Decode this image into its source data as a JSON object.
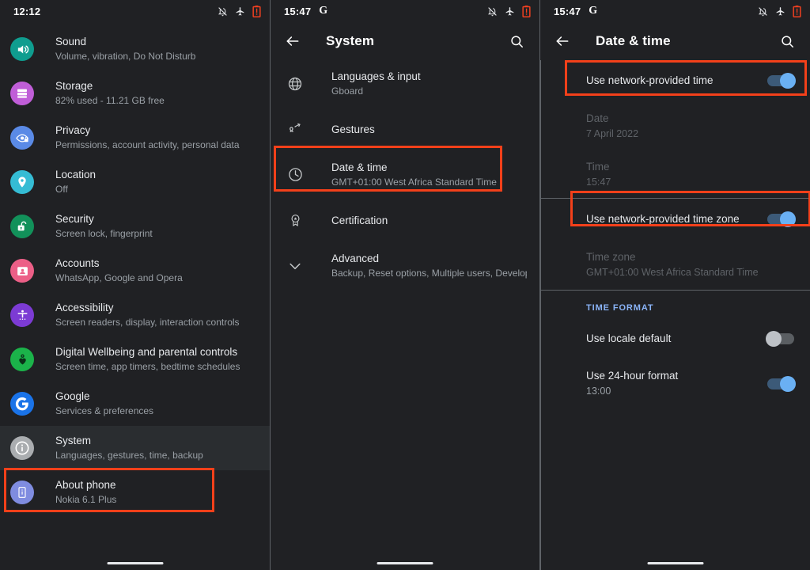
{
  "panels": {
    "settings": {
      "status": {
        "clock": "12:12",
        "glogo": "",
        "icons": [
          "notifications-off-icon",
          "airplane-mode-icon",
          "battery-alert-icon"
        ]
      },
      "items": [
        {
          "title": "Sound",
          "subtitle": "Volume, vibration, Do Not Disturb",
          "icon": "volume-icon",
          "color": "#0f9d8f",
          "selected": false
        },
        {
          "title": "Storage",
          "subtitle": "82% used - 11.21 GB free",
          "icon": "storage-icon",
          "color": "#c05ed8",
          "selected": false
        },
        {
          "title": "Privacy",
          "subtitle": "Permissions, account activity, personal data",
          "icon": "privacy-eye-icon",
          "color": "#5a8ae6",
          "selected": false
        },
        {
          "title": "Location",
          "subtitle": "Off",
          "icon": "location-pin-icon",
          "color": "#35bcd4",
          "selected": false
        },
        {
          "title": "Security",
          "subtitle": "Screen lock, fingerprint",
          "icon": "lock-open-icon",
          "color": "#12915a",
          "selected": false
        },
        {
          "title": "Accounts",
          "subtitle": "WhatsApp, Google and Opera",
          "icon": "accounts-icon",
          "color": "#ec5f87",
          "selected": false
        },
        {
          "title": "Accessibility",
          "subtitle": "Screen readers, display, interaction controls",
          "icon": "accessibility-icon",
          "color": "#7c3bd4",
          "selected": false
        },
        {
          "title": "Digital Wellbeing and parental controls",
          "subtitle": "Screen time, app timers, bedtime schedules",
          "icon": "wellbeing-heart-icon",
          "color": "#1bb34a",
          "selected": false
        },
        {
          "title": "Google",
          "subtitle": "Services & preferences",
          "icon": "google-g-icon",
          "color": "#1a73e8",
          "selected": false
        },
        {
          "title": "System",
          "subtitle": "Languages, gestures, time, backup",
          "icon": "info-circle-icon",
          "color": "#aaadb0",
          "selected": true
        },
        {
          "title": "About phone",
          "subtitle": "Nokia 6.1 Plus",
          "icon": "phone-info-icon",
          "color": "#7f8ce0",
          "selected": false
        }
      ]
    },
    "system": {
      "status": {
        "clock": "15:47",
        "glogo": "G",
        "icons": [
          "notifications-off-icon",
          "airplane-mode-icon",
          "battery-alert-icon"
        ]
      },
      "appbar": {
        "title": "System",
        "back": "back-arrow-icon",
        "search": "search-icon"
      },
      "items": [
        {
          "title": "Languages & input",
          "subtitle": "Gboard",
          "icon": "globe-icon",
          "highlighted": false
        },
        {
          "title": "Gestures",
          "subtitle": "",
          "icon": "gestures-icon",
          "highlighted": false
        },
        {
          "title": "Date & time",
          "subtitle": "GMT+01:00 West Africa Standard Time",
          "icon": "clock-icon",
          "highlighted": true
        },
        {
          "title": "Certification",
          "subtitle": "",
          "icon": "certification-badge-icon",
          "highlighted": false
        },
        {
          "title": "Advanced",
          "subtitle": "Backup, Reset options, Multiple users, Developer o..",
          "icon": "chevron-down-icon",
          "highlighted": false
        }
      ]
    },
    "datetime": {
      "status": {
        "clock": "15:47",
        "glogo": "G",
        "icons": [
          "notifications-off-icon",
          "airplane-mode-icon",
          "battery-alert-icon"
        ]
      },
      "appbar": {
        "title": "Date & time",
        "back": "back-arrow-icon",
        "search": "search-icon"
      },
      "rows": [
        {
          "title": "Use network-provided time",
          "subtitle": "",
          "type": "toggle",
          "state": "on",
          "dim": false,
          "highlighted": true
        },
        {
          "title": "Date",
          "subtitle": "7 April 2022",
          "type": "value",
          "dim": true,
          "highlighted": false
        },
        {
          "title": "Time",
          "subtitle": "15:47",
          "type": "value",
          "dim": true,
          "highlighted": false
        },
        {
          "title": "Use network-provided time zone",
          "subtitle": "",
          "type": "toggle",
          "state": "on",
          "dim": false,
          "highlighted": true
        },
        {
          "title": "Time zone",
          "subtitle": "GMT+01:00 West Africa Standard Time",
          "type": "value",
          "dim": true,
          "highlighted": false
        }
      ],
      "section_title": "TIME FORMAT",
      "format_rows": [
        {
          "title": "Use locale default",
          "subtitle": "",
          "type": "toggle",
          "state": "off",
          "dim": false,
          "highlighted": false
        },
        {
          "title": "Use 24-hour format",
          "subtitle": "13:00",
          "type": "toggle",
          "state": "on",
          "dim": false,
          "highlighted": false
        }
      ]
    }
  },
  "colors": {
    "background": "#202124",
    "selected_row": "#2a2d30",
    "highlight": "#f3401a",
    "accent_blue": "#8ab4f8",
    "toggle_on": "#6ab0f3",
    "toggle_off": "#bdc1c6",
    "primary_text": "#e8eaed",
    "secondary_text": "#9aa0a6",
    "disabled_text": "#5f6368"
  }
}
